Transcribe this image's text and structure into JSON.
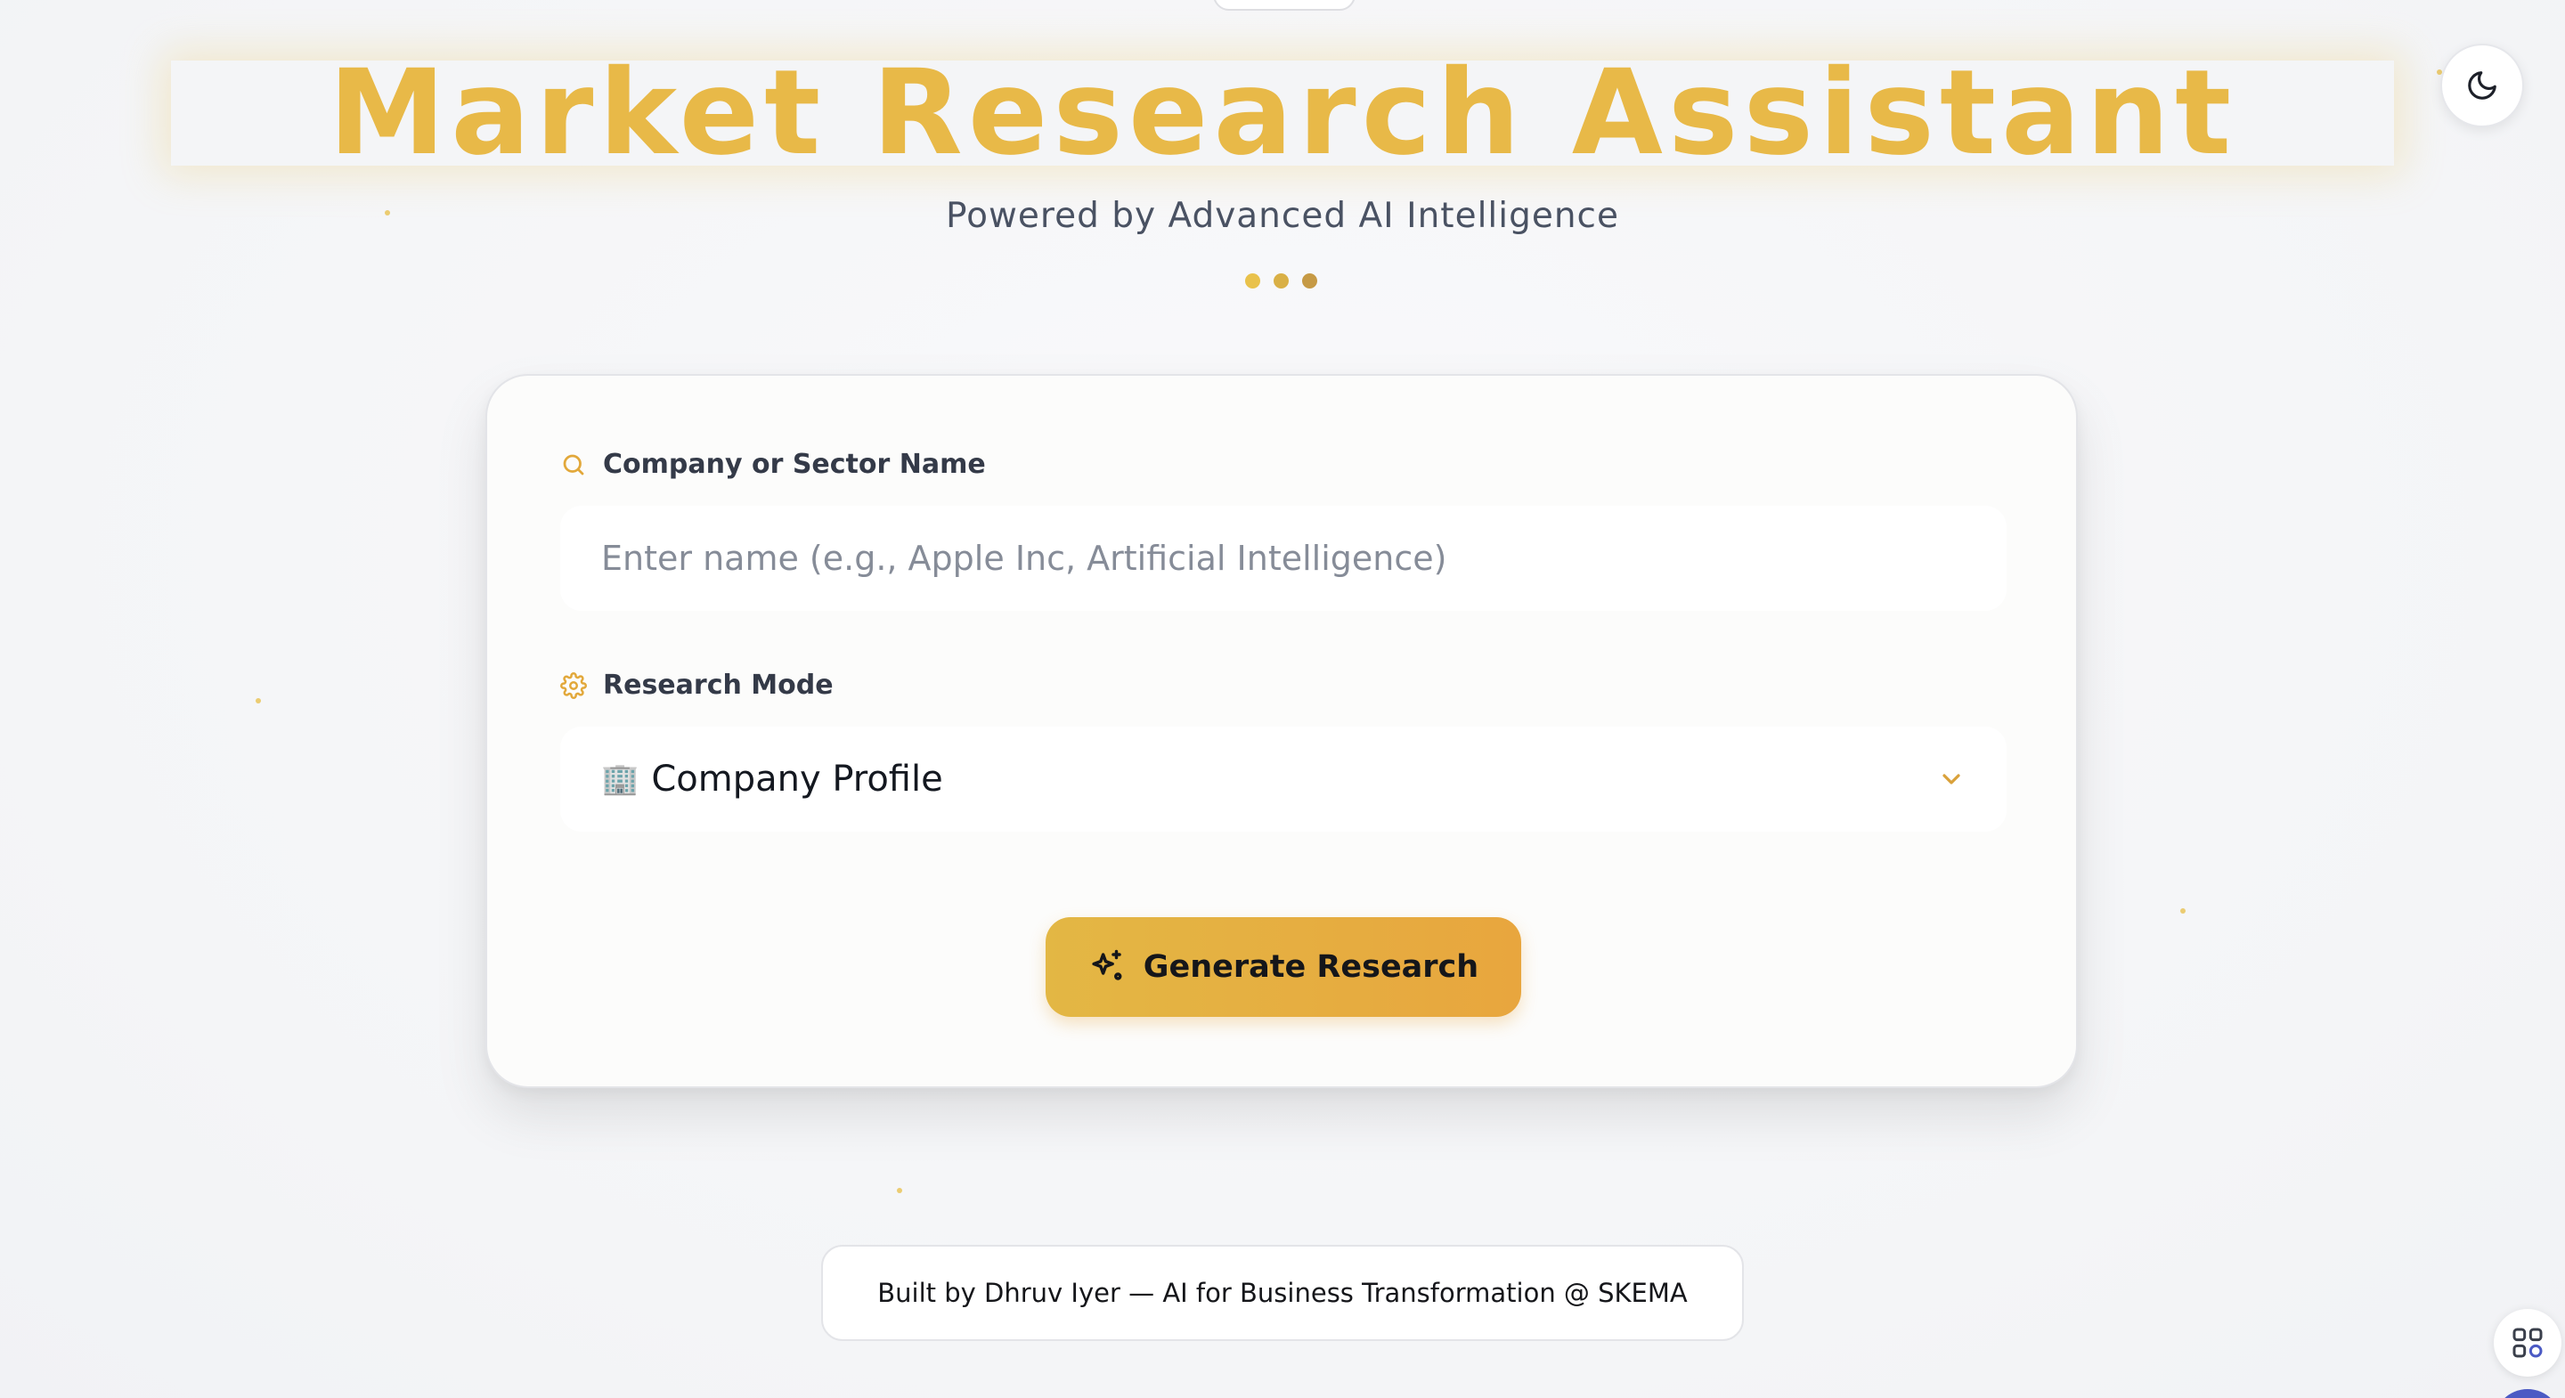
{
  "header": {
    "title": "Market Research Assistant",
    "subtitle": "Powered by Advanced AI Intelligence",
    "loading_dots": [
      "#e9c24b",
      "#d9b046",
      "#c69a45"
    ]
  },
  "theme_toggle": {
    "icon": "moon-icon"
  },
  "form": {
    "name_field": {
      "label": "Company or Sector Name",
      "icon": "search-icon",
      "value": "",
      "placeholder": "Enter name (e.g., Apple Inc, Artificial Intelligence)"
    },
    "mode_field": {
      "label": "Research Mode",
      "icon": "gear-icon",
      "selected_icon": "🏢",
      "selected": "Company Profile",
      "dropdown_icon": "chevron-down-icon"
    },
    "submit": {
      "label": "Generate Research",
      "icon": "sparkles-icon"
    }
  },
  "footer": {
    "text": "Built by Dhruv Iyer — AI for Business Transformation @ SKEMA"
  },
  "colors": {
    "accent": "#e8b948",
    "button_gradient_start": "#e3b744",
    "button_gradient_end": "#e8a63e",
    "text_dark": "#15161a",
    "text_muted": "#4a5263"
  }
}
